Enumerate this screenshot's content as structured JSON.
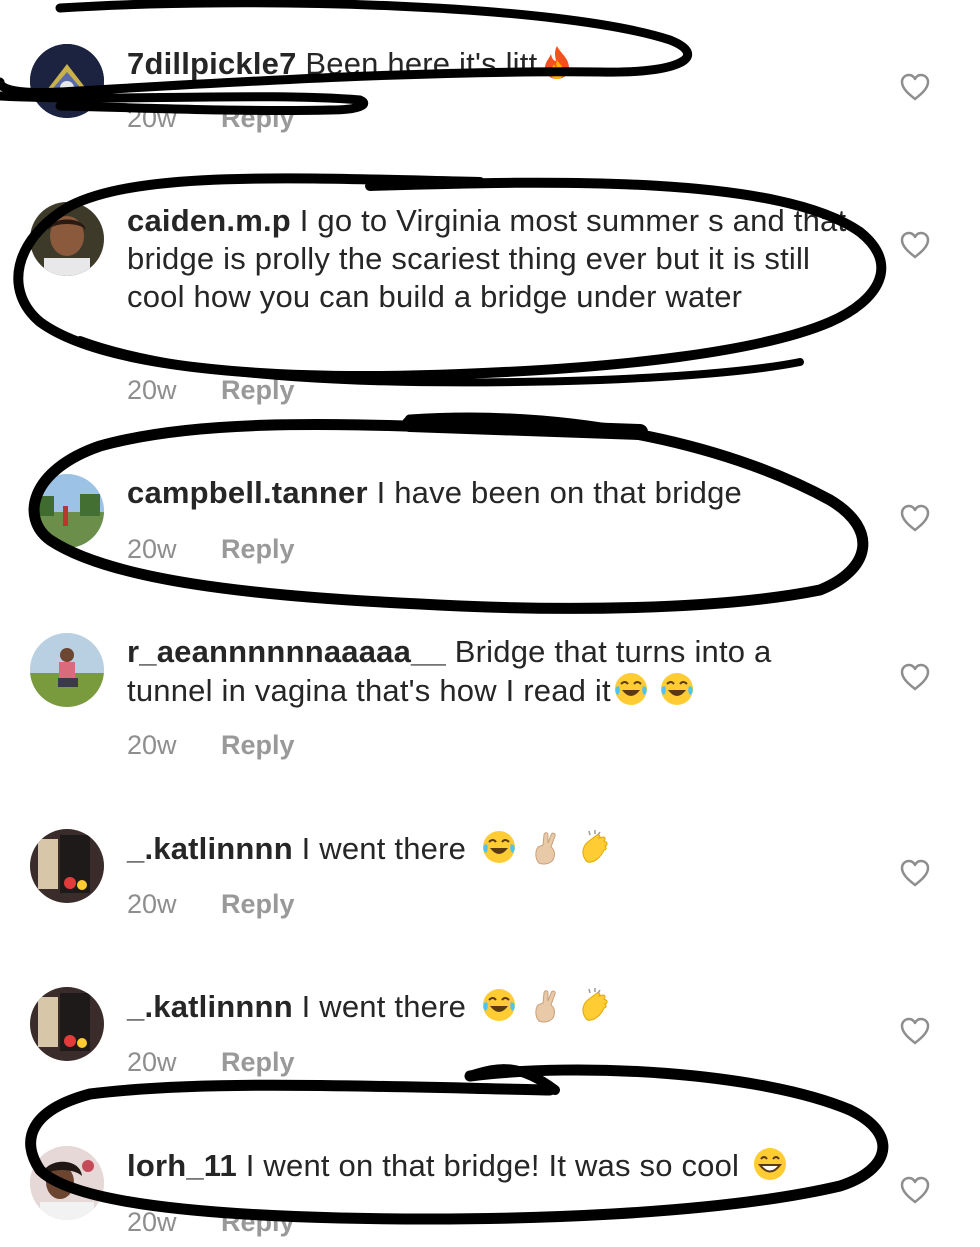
{
  "comments": [
    {
      "username": "7dillpickle7",
      "text": "Been here it's litt",
      "emojis": [
        "fire-emoji"
      ],
      "time": "20w",
      "reply_label": "Reply"
    },
    {
      "username": "caiden.m.p",
      "text": "I go to Virginia most summer s and that bridge is prolly the scariest thing ever but it is still cool how you can build a bridge under water",
      "emojis": [],
      "time": "20w",
      "reply_label": "Reply"
    },
    {
      "username": "campbell.tanner",
      "text": "I have been on that bridge",
      "emojis": [],
      "time": "20w",
      "reply_label": "Reply"
    },
    {
      "username": "r_aeannnnnnaaaaa__",
      "text": "Bridge that turns into a tunnel in vagina that's how I read it",
      "emojis": [
        "joy-emoji",
        "joy-emoji"
      ],
      "time": "20w",
      "reply_label": "Reply"
    },
    {
      "username": "_.katlinnnn",
      "text": "I went there",
      "emojis": [
        "joy-emoji",
        "crossed-fingers-emoji",
        "clapping-hands-emoji"
      ],
      "time": "20w",
      "reply_label": "Reply"
    },
    {
      "username": "_.katlinnnn",
      "text": "I went there",
      "emojis": [
        "joy-emoji",
        "crossed-fingers-emoji",
        "clapping-hands-emoji"
      ],
      "time": "20w",
      "reply_label": "Reply"
    },
    {
      "username": "lorh_11",
      "text": "I went on that bridge! It was so cool",
      "emojis": [
        "grinning-emoji"
      ],
      "time": "20w",
      "reply_label": "Reply"
    }
  ],
  "icons": {
    "like": "heart-outline-icon"
  },
  "colors": {
    "text": "#262626",
    "meta": "#8e8e8e",
    "scribble": "#000000"
  }
}
